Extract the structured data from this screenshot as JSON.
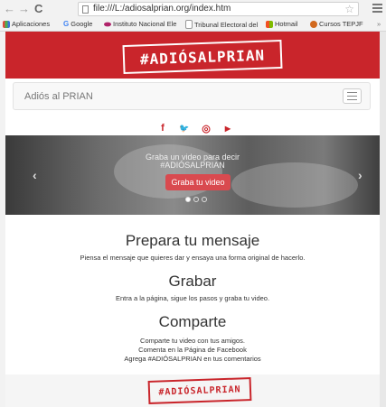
{
  "browser": {
    "url": "file:///L:/adiosalprian.org/index.htm",
    "back_glyph": "←",
    "forward_glyph": "→",
    "reload_glyph": "C",
    "star_glyph": "☆"
  },
  "bookmarks": [
    {
      "label": "Aplicaciones",
      "color": "#e04a3f"
    },
    {
      "label": "Google",
      "color": "#4285f4",
      "prefix": "G"
    },
    {
      "label": "Instituto Nacional Ele",
      "color": "#b0236a"
    },
    {
      "label": "Tribunal Electoral del",
      "color": "#8a8a8a"
    },
    {
      "label": "Hotmail",
      "color": "#f2a71b"
    },
    {
      "label": "Cursos TEPJF",
      "color": "#d2691e"
    }
  ],
  "site": {
    "logo_text": "#ADIÓSALPRIAN",
    "brand": "Adiós al PRIAN",
    "social_icons": [
      "facebook-icon",
      "twitter-icon",
      "instagram-icon",
      "youtube-icon"
    ],
    "social_glyphs": [
      "f",
      "🐦",
      "◎",
      "▶"
    ],
    "carousel": {
      "line1": "Graba un video para decir",
      "line2": "#ADIÓSALPRIAN",
      "button": "Graba tu video",
      "prev": "‹",
      "next": "›"
    },
    "sections": [
      {
        "title": "Prepara tu mensaje",
        "lines": [
          "Piensa el mensaje que quieres dar y ensaya una forma original de hacerlo."
        ]
      },
      {
        "title": "Grabar",
        "lines": [
          "Entra a la página, sigue los pasos y graba tu video."
        ]
      },
      {
        "title": "Comparte",
        "lines": [
          "Comparte tu video con tus amigos.",
          "Comenta en la Página de Facebook",
          "Agrega #ADIÓSALPRIAN en tus comentarios"
        ]
      }
    ],
    "footer_logo": "#ADIÓSALPRIAN",
    "accent": "#c9252b"
  }
}
